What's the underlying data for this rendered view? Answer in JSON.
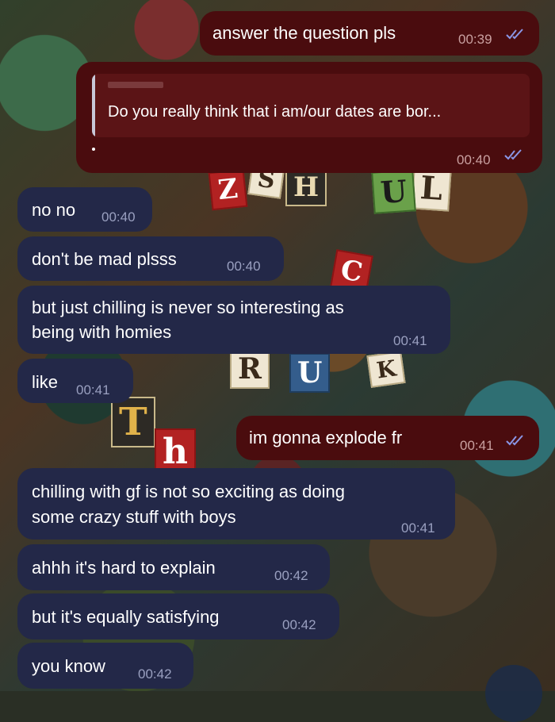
{
  "messages": [
    {
      "dir": "out",
      "text": "answer the question pls",
      "time": "00:39"
    },
    {
      "dir": "out",
      "quote": "Do you really think that i am/our dates are bor...",
      "time": "00:40"
    },
    {
      "dir": "in",
      "text": "no no",
      "time": "00:40"
    },
    {
      "dir": "in",
      "text": "don't be mad plsss",
      "time": "00:40"
    },
    {
      "dir": "in",
      "line1": "but just chilling is never so interesting as",
      "line2": "being with homies",
      "time": "00:41"
    },
    {
      "dir": "in",
      "text": "like",
      "time": "00:41"
    },
    {
      "dir": "out",
      "text": "im gonna explode fr",
      "time": "00:41"
    },
    {
      "dir": "in",
      "line1": "chilling with gf is not so exciting as doing",
      "line2": "some crazy stuff with boys",
      "time": "00:41"
    },
    {
      "dir": "in",
      "text": "ahhh it's hard to explain",
      "time": "00:42"
    },
    {
      "dir": "in",
      "text": "but it's equally satisfying",
      "time": "00:42"
    },
    {
      "dir": "in",
      "text": "you know",
      "time": "00:42"
    }
  ],
  "wallpaper_letters": [
    "L",
    "Z",
    "S",
    "H",
    "U",
    "L",
    "C",
    "R",
    "U",
    "K",
    "S",
    "T",
    "h"
  ],
  "colors": {
    "incoming_bubble": "#232848",
    "outgoing_bubble": "#4a0c0e",
    "quote_background": "#5b1416",
    "read_ticks": "#8a96e6"
  },
  "icons": {
    "read_receipt": "double-check-icon",
    "scroll_down": "scroll-down-button"
  }
}
